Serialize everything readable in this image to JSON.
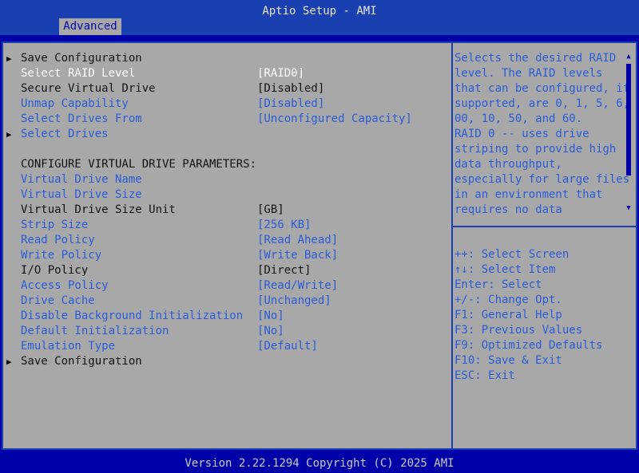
{
  "header": {
    "title": "Aptio Setup - AMI",
    "tab": "Advanced"
  },
  "colors": {
    "background": "#0000a8",
    "panel": "#a8a8a8",
    "link": "#2a5bd8",
    "selected": "#ffffff"
  },
  "items": [
    {
      "arrow": "▶",
      "label": "Save Configuration",
      "value": "",
      "style": "dark"
    },
    {
      "arrow": "",
      "label": "Select RAID Level",
      "value": "[RAID0]",
      "style": "selected"
    },
    {
      "arrow": "",
      "label": "Secure Virtual Drive",
      "value": "[Disabled]",
      "style": "dark"
    },
    {
      "arrow": "",
      "label": "Unmap Capability",
      "value": "[Disabled]",
      "style": "link"
    },
    {
      "arrow": "",
      "label": "Select Drives From",
      "value": "[Unconfigured Capacity]",
      "style": "link"
    },
    {
      "arrow": "▶",
      "label": "Select Drives",
      "value": "",
      "style": "link"
    },
    {
      "arrow": "",
      "label": "",
      "value": "",
      "style": "dark"
    },
    {
      "arrow": "",
      "label": "CONFIGURE VIRTUAL DRIVE PARAMETERS:",
      "value": "",
      "style": "dark"
    },
    {
      "arrow": "",
      "label": "Virtual Drive Name",
      "value": "",
      "style": "link"
    },
    {
      "arrow": "",
      "label": "Virtual Drive Size",
      "value": "",
      "style": "link"
    },
    {
      "arrow": "",
      "label": "Virtual Drive Size Unit",
      "value": "[GB]",
      "style": "dark"
    },
    {
      "arrow": "",
      "label": "Strip Size",
      "value": "[256 KB]",
      "style": "link"
    },
    {
      "arrow": "",
      "label": "Read Policy",
      "value": "[Read Ahead]",
      "style": "link"
    },
    {
      "arrow": "",
      "label": "Write Policy",
      "value": "[Write Back]",
      "style": "link"
    },
    {
      "arrow": "",
      "label": "I/O Policy",
      "value": "[Direct]",
      "style": "dark"
    },
    {
      "arrow": "",
      "label": "Access Policy",
      "value": "[Read/Write]",
      "style": "link"
    },
    {
      "arrow": "",
      "label": "Drive Cache",
      "value": "[Unchanged]",
      "style": "link"
    },
    {
      "arrow": "",
      "label": "Disable Background Initialization",
      "value": "[No]",
      "style": "link"
    },
    {
      "arrow": "",
      "label": "Default Initialization",
      "value": "[No]",
      "style": "link"
    },
    {
      "arrow": "",
      "label": "Emulation Type",
      "value": "[Default]",
      "style": "link"
    },
    {
      "arrow": "▶",
      "label": "Save Configuration",
      "value": "",
      "style": "dark"
    }
  ],
  "help": {
    "lines": [
      "Selects the desired RAID",
      "level. The RAID levels",
      "that can be configured, if",
      "supported, are 0, 1, 5, 6,",
      "00, 10, 50, and 60.",
      "RAID 0 -- uses drive",
      "striping to provide high",
      "data throughput,",
      "especially for large files",
      "in an environment that",
      "requires no data"
    ],
    "scroll_up": "▲",
    "scroll_down": "▼"
  },
  "keys": [
    "++: Select Screen",
    "↑↓: Select Item",
    "Enter: Select",
    "+/-: Change Opt.",
    "F1: General Help",
    "F3: Previous Values",
    "F9: Optimized Defaults",
    "F10: Save & Exit",
    "ESC: Exit"
  ],
  "footer": "Version 2.22.1294 Copyright (C) 2025 AMI"
}
